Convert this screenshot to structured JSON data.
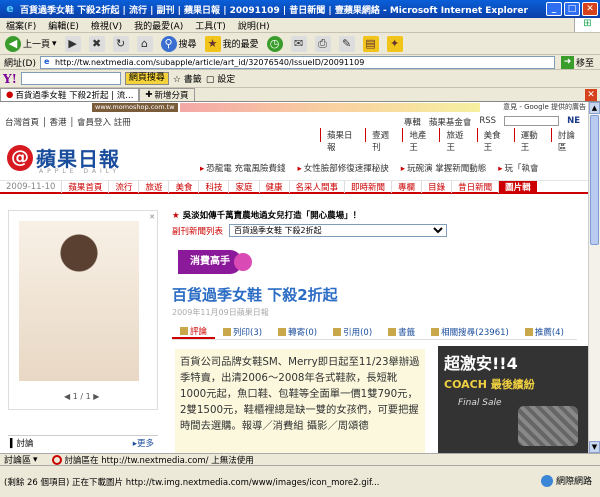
{
  "window": {
    "title": "百貨過季女鞋 下殺2折起 | 流行 | 副刊 | 蘋果日報 | 20091109 | 昔日新聞 | 壹蘋果網絡 - Microsoft Internet Explorer",
    "min": "_",
    "max": "□",
    "close": "✕"
  },
  "menubar": [
    "檔案(F)",
    "編輯(E)",
    "檢視(V)",
    "我的最愛(A)",
    "工具(T)",
    "說明(H)"
  ],
  "toolbar": {
    "back": "上一頁",
    "search": "搜尋",
    "favorites": "我的最愛"
  },
  "address": {
    "label": "網址(D)",
    "url": "http://tw.nextmedia.com/subapple/article/art_id/32076540/IssueID/20091109",
    "go": "移至"
  },
  "yahoo": {
    "logo": "Y!",
    "search_btn": "網頁搜尋",
    "bookmarks": "書籤",
    "settings": "設定"
  },
  "tabs": [
    {
      "label": "百貨過季女鞋 下殺2折起 | 流..."
    },
    {
      "label": "新增分頁"
    }
  ],
  "page": {
    "promo_site": "www.momoshop.com.tw",
    "google_ads": "意見 - Google 提供的廣告",
    "toplinks_left": "台灣首頁 │ 香港 │ 會員登入  註冊",
    "toplinks_right": [
      "專輯",
      "蘋果基金會",
      "RSS"
    ],
    "nex": "NE",
    "channels": [
      "蘋果日報",
      "壹週刊",
      "地產王",
      "旅遊王",
      "美食王",
      "運動王",
      "討論區"
    ],
    "logo_name": "蘋果日報",
    "logo_sub": "APPLE DAILY",
    "ticker": [
      "恐龍電 充電風險費錢",
      "女性臉部修復速揮秘訣",
      "玩碗演 掌握新聞動態",
      "玩「執會"
    ],
    "nav_date": "2009-11-10",
    "nav_items": [
      "蘋果首頁",
      "流行",
      "旅遊",
      "美食",
      "科技",
      "家庭",
      "健康",
      "名采人間事",
      "即時新聞",
      "專欄",
      "目錄",
      "昔日新聞",
      "圖片輯"
    ],
    "photo_pager": "1 / 1",
    "farm_tag": "吳淡如傳千萬賣農地過女兒打造「開心農場」！",
    "side_news_label": "副刊新聞列表",
    "side_news_value": "百貨過季女鞋 下殺2折起",
    "badge": "消費高手",
    "headline": "百貨過季女鞋 下殺2折起",
    "headline_date": "2009年11月09日蘋果日報",
    "actions": [
      "評論",
      "列印(3)",
      "轉寄(0)",
      "引用(0)",
      "書籤",
      "相關搜尋(23961)",
      "推薦(4)"
    ],
    "body": "百貨公司品牌女鞋SM、Merry即日起至11/23舉辦過季特賣，出清2006～2008年各式鞋款，長短靴1000元起，魚口鞋、包鞋等全面單一價1雙790元，2雙1500元，鞋櫃裡總是缺一雙的女孩們，可要把握時間去選購。報導／消費組 攝影／周頌德",
    "ad": {
      "headline": "超激安!!4",
      "coach": "COACH 最後繽紛",
      "sub": "Final Sale"
    },
    "discuss_title": "討論",
    "discuss_more": "更多"
  },
  "hscroll": {
    "discuss": "討論區",
    "msg": "討論區在 http://tw.nextmedia.com/ 上無法使用"
  },
  "status": {
    "text": "(剩餘 26 個項目) 正在下載圖片 http://tw.img.nextmedia.com/www/images/icon_more2.gif...",
    "zone": "網際網路"
  }
}
